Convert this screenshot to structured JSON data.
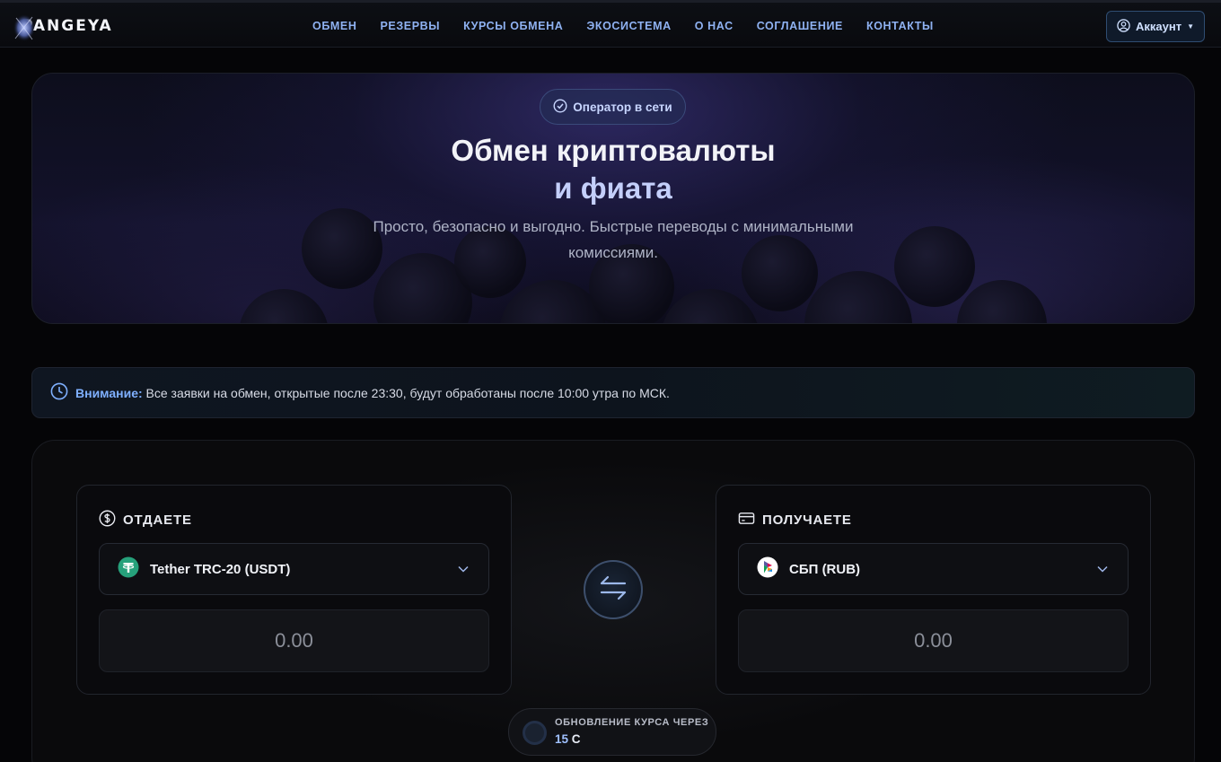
{
  "brand": {
    "name": "PANGEYA"
  },
  "nav": {
    "items": [
      {
        "label": "ОБМЕН"
      },
      {
        "label": "РЕЗЕРВЫ"
      },
      {
        "label": "КУРСЫ ОБМЕНА"
      },
      {
        "label": "ЭКОСИСТЕМА"
      },
      {
        "label": "О НАС"
      },
      {
        "label": "СОГЛАШЕНИЕ"
      },
      {
        "label": "КОНТАКТЫ"
      }
    ]
  },
  "account": {
    "label": "Аккаунт",
    "icon": "user-circle-icon"
  },
  "hero": {
    "status": "Оператор в сети",
    "title_line1": "Обмен криптовалюты",
    "title_line2": "и фиата",
    "subtitle": "Просто, безопасно и выгодно. Быстрые переводы с минимальными комиссиями."
  },
  "notice": {
    "prefix": "Внимание:",
    "text": "Все заявки на обмен, открытые после 23:30, будут обработаны после 10:00 утра по МСК.",
    "icon": "clock-icon"
  },
  "exchange": {
    "give": {
      "heading": "ОТДАЕТЕ",
      "icon": "dollar-circle-icon",
      "currency": "Tether TRC-20 (USDT)",
      "currency_icon": "tether-icon",
      "amount_placeholder": "0.00"
    },
    "get": {
      "heading": "ПОЛУЧАЕТЕ",
      "icon": "card-icon",
      "currency": "СБП (RUB)",
      "currency_icon": "sbp-icon",
      "amount_placeholder": "0.00"
    },
    "timer": {
      "label": "ОБНОВЛЕНИЕ КУРСА ЧЕРЕЗ",
      "value": "15",
      "unit": "С"
    }
  },
  "colors": {
    "accent": "#8fb2f2",
    "background": "#050507",
    "tether": "#26a17b"
  }
}
